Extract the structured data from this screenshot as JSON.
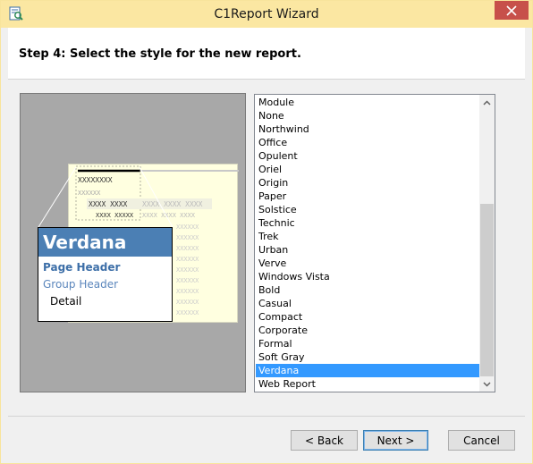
{
  "window": {
    "title": "C1Report Wizard"
  },
  "header": {
    "step_title": "Step 4: Select the style for the new report."
  },
  "preview": {
    "style_name": "Verdana",
    "page_header": "Page Header",
    "group_header": "Group Header",
    "detail": "Detail",
    "accent_color": "#4b7fb4"
  },
  "style_list": {
    "items": [
      {
        "label": "Module"
      },
      {
        "label": "None"
      },
      {
        "label": "Northwind"
      },
      {
        "label": "Office"
      },
      {
        "label": "Opulent"
      },
      {
        "label": "Oriel"
      },
      {
        "label": "Origin"
      },
      {
        "label": "Paper"
      },
      {
        "label": "Solstice"
      },
      {
        "label": "Technic"
      },
      {
        "label": "Trek"
      },
      {
        "label": "Urban"
      },
      {
        "label": "Verve"
      },
      {
        "label": "Windows Vista"
      },
      {
        "label": "Bold"
      },
      {
        "label": "Casual"
      },
      {
        "label": "Compact"
      },
      {
        "label": "Corporate"
      },
      {
        "label": "Formal"
      },
      {
        "label": "Soft Gray"
      },
      {
        "label": "Verdana",
        "selected": true
      },
      {
        "label": "Web Report"
      }
    ],
    "selected": "Verdana"
  },
  "buttons": {
    "back": "< Back",
    "next": "Next >",
    "cancel": "Cancel"
  }
}
